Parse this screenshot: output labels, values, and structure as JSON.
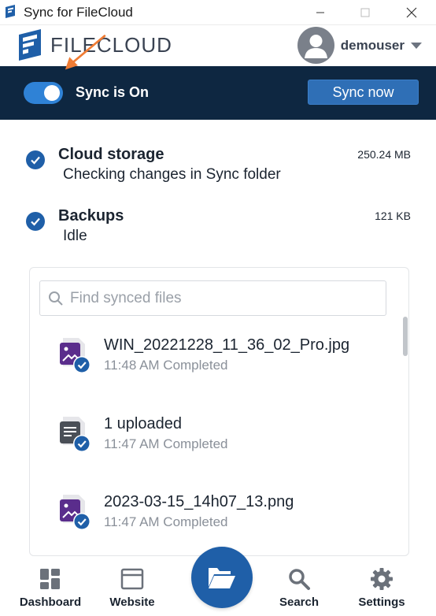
{
  "window": {
    "title": "Sync for FileCloud"
  },
  "header": {
    "brand": "FILECLOUD",
    "username": "demouser"
  },
  "sync_bar": {
    "status_label": "Sync is On",
    "toggle_on": true,
    "sync_now_label": "Sync now",
    "accent": "#2f82d6",
    "background": "#0e2741"
  },
  "status_items": [
    {
      "title": "Cloud storage",
      "subtitle": "Checking changes in Sync folder",
      "size": "250.24 MB"
    },
    {
      "title": "Backups",
      "subtitle": "Idle",
      "size": "121 KB"
    }
  ],
  "search": {
    "placeholder": "Find synced files"
  },
  "files": [
    {
      "name": "WIN_20221228_11_36_02_Pro.jpg",
      "meta": "11:48 AM Completed",
      "icon": "image-file-icon"
    },
    {
      "name": "1 uploaded",
      "meta": "11:47 AM Completed",
      "icon": "document-file-icon"
    },
    {
      "name": "2023-03-15_14h07_13.png",
      "meta": "11:47 AM Completed",
      "icon": "image-file-icon"
    }
  ],
  "bottom_nav": {
    "dashboard": "Dashboard",
    "website": "Website",
    "search": "Search",
    "settings": "Settings",
    "center_icon": "folder-open-icon"
  },
  "colors": {
    "primary_blue": "#1f5fa8",
    "image_icon_purple": "#5a2d8c",
    "doc_icon_gray": "#4a4f57",
    "annotation_arrow": "#f07c34"
  }
}
